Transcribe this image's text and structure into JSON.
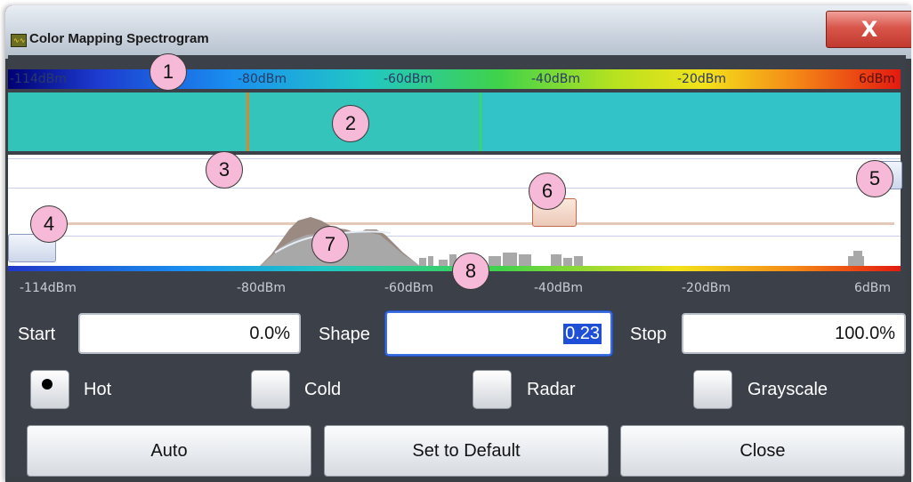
{
  "window": {
    "title": "Color Mapping Spectrogram",
    "close_glyph": "X"
  },
  "scale": {
    "labels": [
      "-114dBm",
      "-80dBm",
      "-60dBm",
      "-40dBm",
      "-20dBm",
      "6dBm"
    ]
  },
  "axis": {
    "labels": [
      "-114dBm",
      "-80dBm",
      "-60dBm",
      "-40dBm",
      "-20dBm",
      "6dBm"
    ]
  },
  "fields": {
    "start": {
      "label": "Start",
      "value": "0.0%"
    },
    "shape": {
      "label": "Shape",
      "value": "0.23"
    },
    "stop": {
      "label": "Stop",
      "value": "100.0%"
    }
  },
  "color_schemes": [
    {
      "label": "Hot",
      "selected": true
    },
    {
      "label": "Cold",
      "selected": false
    },
    {
      "label": "Radar",
      "selected": false
    },
    {
      "label": "Grayscale",
      "selected": false
    }
  ],
  "buttons": {
    "auto": "Auto",
    "default": "Set to Default",
    "close": "Close"
  },
  "callouts": [
    "1",
    "2",
    "3",
    "4",
    "5",
    "6",
    "7",
    "8"
  ],
  "icons": {
    "app": "spectrogram-icon",
    "close": "close-icon"
  }
}
